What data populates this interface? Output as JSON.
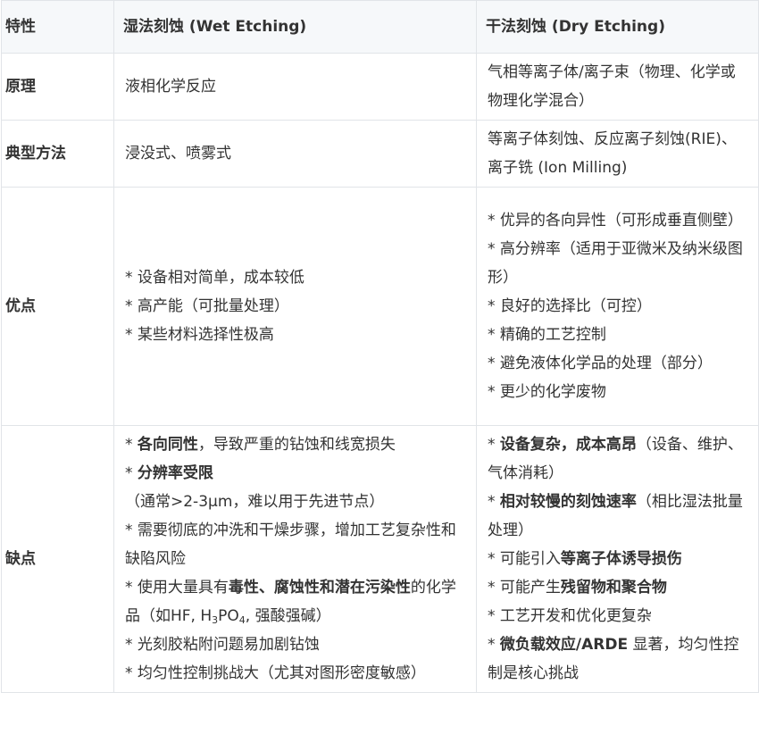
{
  "headers": {
    "feature": "特性",
    "wet": "湿法刻蚀 (Wet Etching)",
    "dry": "干法刻蚀 (Dry Etching)"
  },
  "rows": {
    "principle": {
      "label": "原理",
      "wet": "液相化学反应",
      "dry": "气相等离子体/离子束（物理、化学或物理化学混合）"
    },
    "method": {
      "label": "典型方法",
      "wet": "浸没式、喷雾式",
      "dry": "等离子体刻蚀、反应离子刻蚀(RIE)、离子铣 (Ion Milling)"
    },
    "advantages": {
      "label": "优点",
      "wet": [
        "* 设备相对简单，成本较低",
        "* 高产能（可批量处理）",
        "* 某些材料选择性极高"
      ],
      "dry": [
        "* 优异的各向异性（可形成垂直侧壁）",
        "* 高分辨率（适用于亚微米及纳米级图形）",
        "* 良好的选择比（可控）",
        "* 精确的工艺控制",
        "* 避免液体化学品的处理（部分）",
        "* 更少的化学废物"
      ]
    },
    "disadvantages": {
      "label": "缺点",
      "wet": {
        "d1_prefix": "* ",
        "d1_bold": "各向同性",
        "d1_rest": "，导致严重的钻蚀和线宽损失",
        "d2_prefix": "* ",
        "d2_bold": "分辨率受限",
        "d2_rest": "（通常>2-3μm，难以用于先进节点）",
        "d3": "* 需要彻底的冲洗和干燥步骤，增加工艺复杂性和缺陷风险",
        "d4_prefix": "* 使用大量具有",
        "d4_bold": "毒性、腐蚀性和潜在污染性",
        "d4_rest": "的化学品（如HF, H",
        "d4_sub1": "3",
        "d4_mid": "PO",
        "d4_sub2": "4",
        "d4_end": ", 强酸强碱）",
        "d5": "* 光刻胶粘附问题易加剧钻蚀",
        "d6": "* 均匀性控制挑战大（尤其对图形密度敏感）"
      },
      "dry": {
        "d1_prefix": "* ",
        "d1_bold": "设备复杂，成本高昂",
        "d1_rest": "（设备、维护、气体消耗）",
        "d2_prefix": "* ",
        "d2_bold": "相对较慢的刻蚀速率",
        "d2_rest": "（相比湿法批量处理）",
        "d3_prefix": "* 可能引入",
        "d3_bold": "等离子体诱导损伤",
        "d4_prefix": "* 可能产生",
        "d4_bold": "残留物和聚合物",
        "d5": "* 工艺开发和优化更复杂",
        "d6_prefix": "* ",
        "d6_bold": "微负载效应/ARDE",
        "d6_rest": " 显著，均匀性控制是核心挑战"
      }
    }
  }
}
